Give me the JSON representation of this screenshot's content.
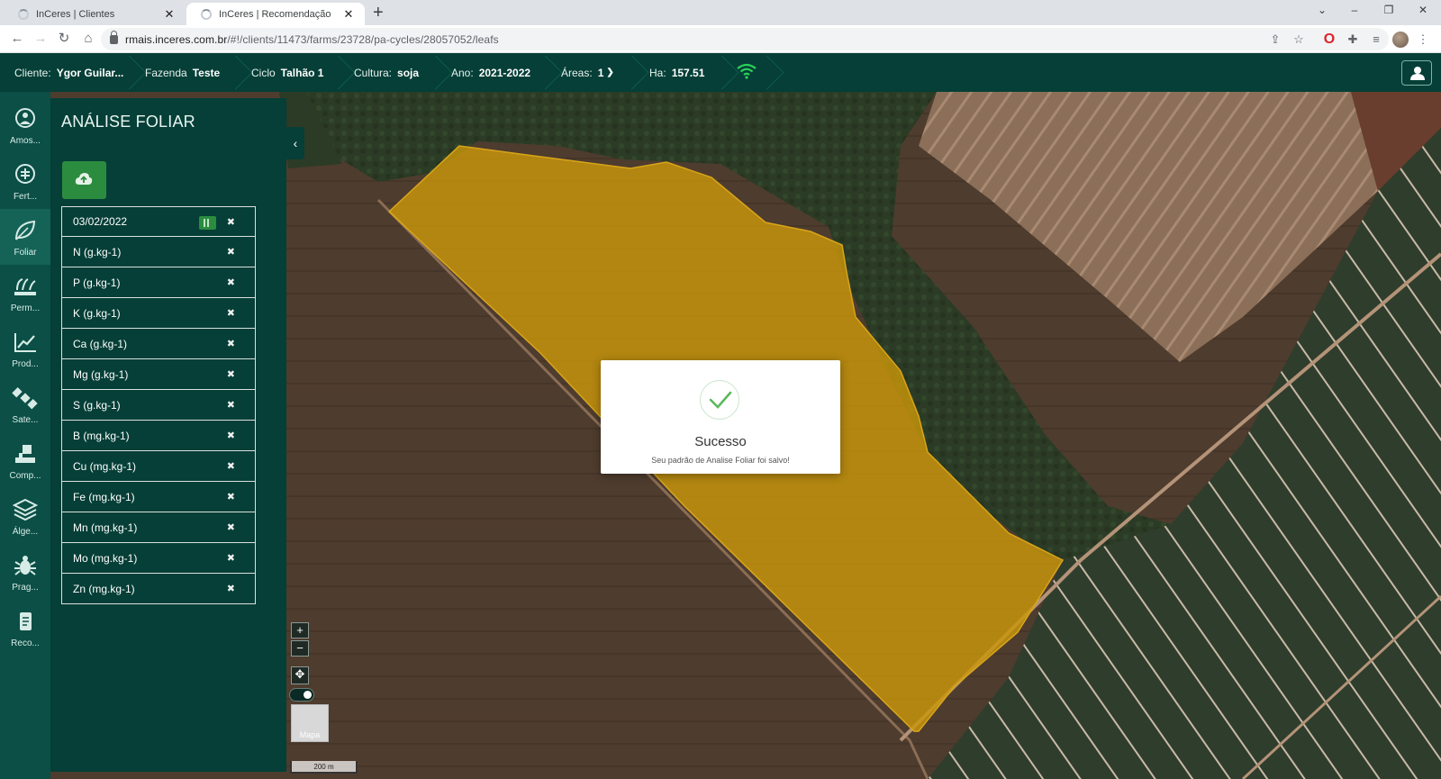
{
  "browser": {
    "tabs": [
      {
        "label": "InCeres | Clientes",
        "active": false
      },
      {
        "label": "InCeres | Recomendação",
        "active": true
      }
    ],
    "new_tab": "+",
    "url_domain": "rmais.inceres.com.br",
    "url_path": "/#!/clients/11473/farms/23728/pa-cycles/28057052/leafs"
  },
  "header": {
    "cliente_label": "Cliente:",
    "cliente_value": "Ygor Guilar...",
    "fazenda_label": "Fazenda",
    "fazenda_value": "Teste",
    "ciclo_label": "Ciclo",
    "ciclo_value": "Talhão 1",
    "cultura_label": "Cultura:",
    "cultura_value": "soja",
    "ano_label": "Ano:",
    "ano_value": "2021-2022",
    "areas_label": "Áreas:",
    "areas_value": "1",
    "ha_label": "Ha:",
    "ha_value": "157.51",
    "accent_color": "#2bd15a"
  },
  "rail": {
    "items": [
      {
        "label": "Amos...",
        "icon": "sampling-icon",
        "active": false
      },
      {
        "label": "Fert...",
        "icon": "fertility-icon",
        "active": false
      },
      {
        "label": "Foliar",
        "icon": "leaf-icon",
        "active": true
      },
      {
        "label": "Perm...",
        "icon": "permission-icon",
        "active": false
      },
      {
        "label": "Prod...",
        "icon": "productivity-chart-icon",
        "active": false
      },
      {
        "label": "Sate...",
        "icon": "satellite-icon",
        "active": false
      },
      {
        "label": "Comp...",
        "icon": "compaction-icon",
        "active": false
      },
      {
        "label": "Álge...",
        "icon": "layers-icon",
        "active": false
      },
      {
        "label": "Prag...",
        "icon": "bug-icon",
        "active": false
      },
      {
        "label": "Reco...",
        "icon": "recommendation-icon",
        "active": false
      }
    ]
  },
  "panel": {
    "title": "ANÁLISE FOLIAR",
    "upload_icon": "cloud-upload-icon",
    "rows": [
      {
        "label": "03/02/2022",
        "has_badge": true
      },
      {
        "label": "N (g.kg-1)"
      },
      {
        "label": "P (g.kg-1)"
      },
      {
        "label": "K (g.kg-1)"
      },
      {
        "label": "Ca (g.kg-1)"
      },
      {
        "label": "Mg (g.kg-1)"
      },
      {
        "label": "S (g.kg-1)"
      },
      {
        "label": "B (mg.kg-1)"
      },
      {
        "label": "Cu (mg.kg-1)"
      },
      {
        "label": "Fe (mg.kg-1)"
      },
      {
        "label": "Mn (mg.kg-1)"
      },
      {
        "label": "Mo (mg.kg-1)"
      },
      {
        "label": "Zn (mg.kg-1)"
      }
    ],
    "remove_glyph": "✖"
  },
  "map": {
    "zoom_in": "+",
    "zoom_out": "−",
    "basemap_label": "Mapa",
    "scale_label": "200 m",
    "field_color": "#c8960a"
  },
  "dialog": {
    "title": "Sucesso",
    "message": "Seu padrão de Analise Foliar foi salvo!",
    "check_color": "#5cb85c"
  }
}
